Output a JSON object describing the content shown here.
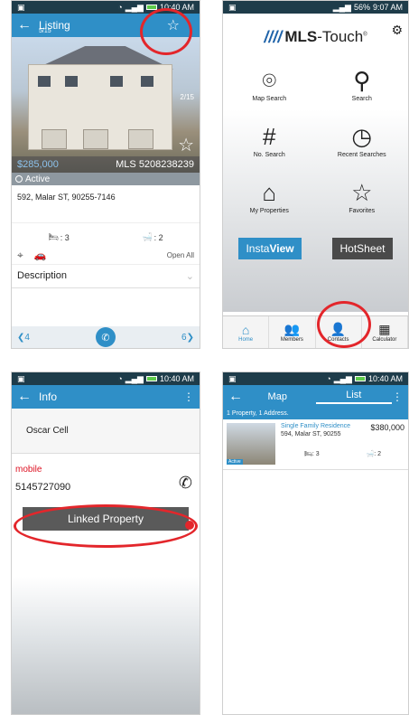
{
  "status": {
    "time_p1": "10:40 AM",
    "time_p2": "9:07 AM",
    "time_p3": "10:40 AM",
    "time_p4": "10:40 AM",
    "battery_p2": "56%"
  },
  "listing": {
    "title": "Listing",
    "sub": "5/15",
    "photo_count": "2/15",
    "price": "$285,000",
    "mls": "MLS 5208238239",
    "status": "Active",
    "address": "592, Malar ST, 90255-7146",
    "beds": ": 3",
    "baths": ": 2",
    "open_all": "Open All",
    "description": "Description",
    "prev": "4",
    "next": "6"
  },
  "home": {
    "logo_slashes": "////",
    "logo_bold": "MLS",
    "logo_rest": "-Touch",
    "tiles": [
      {
        "label": "Map Search",
        "icon": "map-pin-icon"
      },
      {
        "label": "Search",
        "icon": "search-icon"
      },
      {
        "label": "No. Search",
        "icon": "hash-icon"
      },
      {
        "label": "Recent Searches",
        "icon": "clock-icon"
      },
      {
        "label": "My Properties",
        "icon": "home-icon"
      },
      {
        "label": "Favorites",
        "icon": "star-icon"
      }
    ],
    "insta": "InstaView",
    "insta_a": "Insta",
    "insta_b": "View",
    "hotsheet": "HotSheet",
    "tabs": [
      "Home",
      "Members",
      "Contacts",
      "Calculator"
    ]
  },
  "info": {
    "title": "Info",
    "name": "Oscar Cell",
    "phone_label": "mobile",
    "phone_number": "5145727090",
    "linked": "Linked Property"
  },
  "results": {
    "tab_map": "Map",
    "tab_list": "List",
    "summary": "1 Property, 1 Address.",
    "item": {
      "type": "Single Family Residence",
      "address": "594, Malar ST, 90255",
      "price": "$380,000",
      "beds": ": 3",
      "baths": ": 2",
      "status": "Active"
    }
  },
  "colors": {
    "accent": "#2f8fc7",
    "annotation": "#e3262b"
  }
}
